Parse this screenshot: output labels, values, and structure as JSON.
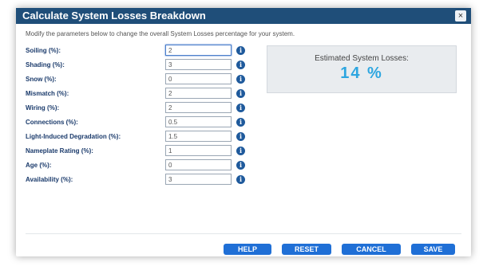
{
  "dialog": {
    "title": "Calculate System Losses Breakdown",
    "close_icon": "×",
    "description": "Modify the parameters below to change the overall System Losses percentage for your system.",
    "fields": [
      {
        "label": "Soiling (%):",
        "value": "2"
      },
      {
        "label": "Shading (%):",
        "value": "3"
      },
      {
        "label": "Snow (%):",
        "value": "0"
      },
      {
        "label": "Mismatch (%):",
        "value": "2"
      },
      {
        "label": "Wiring (%):",
        "value": "2"
      },
      {
        "label": "Connections (%):",
        "value": "0.5"
      },
      {
        "label": "Light-Induced Degradation (%):",
        "value": "1.5"
      },
      {
        "label": "Nameplate Rating (%):",
        "value": "1"
      },
      {
        "label": "Age (%):",
        "value": "0"
      },
      {
        "label": "Availability (%):",
        "value": "3"
      }
    ],
    "summary": {
      "label": "Estimated System Losses:",
      "value": "14 %"
    },
    "buttons": {
      "help": "HELP",
      "reset": "RESET",
      "cancel": "CANCEL",
      "save": "SAVE"
    }
  }
}
